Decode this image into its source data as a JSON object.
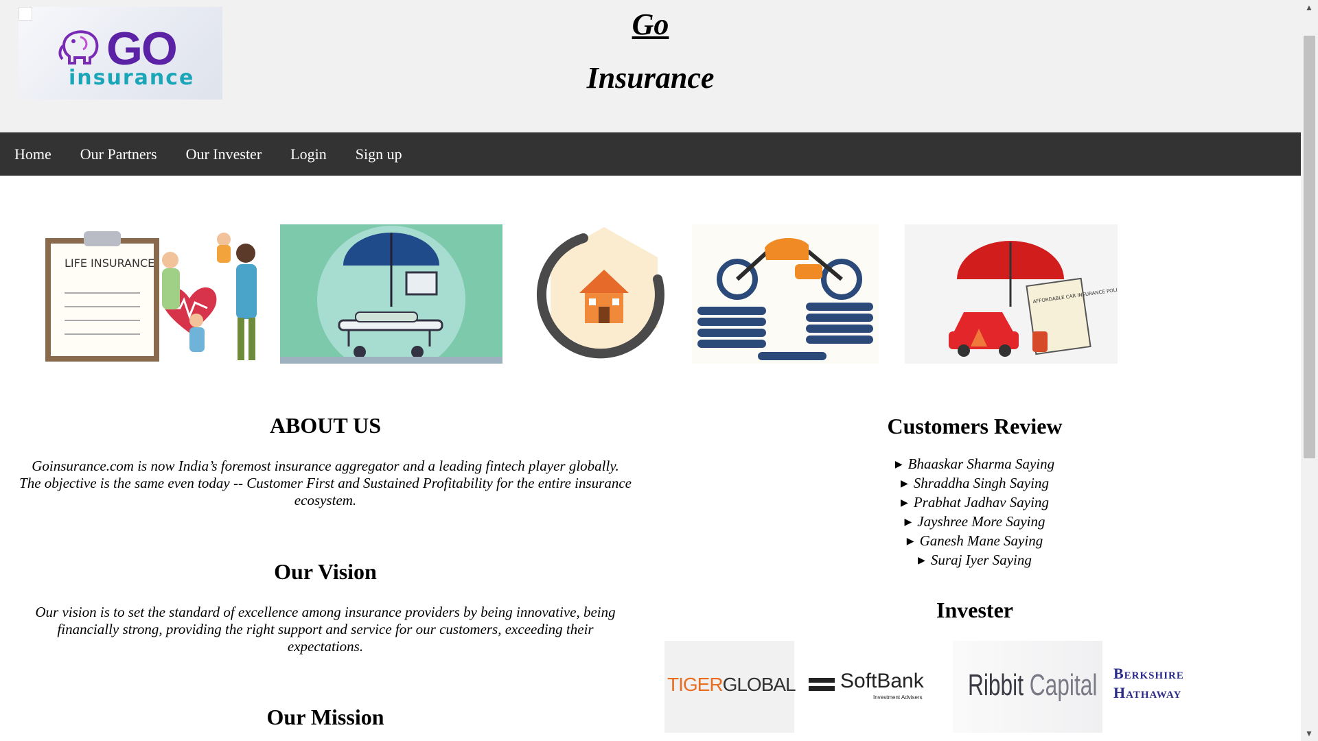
{
  "header": {
    "logo_go": "GO",
    "logo_insurance": "insurance",
    "title_line1": "Go",
    "title_line2": "Insurance"
  },
  "nav": {
    "items": [
      "Home",
      "Our Partners",
      "Our Invester",
      "Login",
      "Sign up"
    ]
  },
  "gallery": {
    "life_label": "LIFE INSURANCE",
    "car_policy_label": "AFFORDABLE CAR INSURANCE POLICY"
  },
  "about": {
    "title": "ABOUT US",
    "text": "Goinsurance.com is now India’s foremost insurance aggregator and a leading fintech player globally. The objective is the same even today -- Customer First and Sustained Profitability for the entire insurance ecosystem."
  },
  "vision": {
    "title": "Our Vision",
    "text": "Our vision is to set the standard of excellence among insurance providers by being innovative, being financially strong, providing the right support and service for our customers, exceeding their expectations."
  },
  "mission": {
    "title": "Our Mission"
  },
  "reviews": {
    "title": "Customers Review",
    "items": [
      "Bhaaskar Sharma Saying",
      "Shraddha Singh Saying",
      "Prabhat Jadhav Saying",
      "Jayshree More Saying",
      "Ganesh Mane Saying",
      "Suraj Iyer Saying"
    ]
  },
  "investors": {
    "title": "Invester",
    "tiger_a": "TIGER",
    "tiger_b": "GLOBAL",
    "softbank": "SoftBank",
    "softbank_sub": "Investment Advisers",
    "ribbit_a": "Ribbit",
    "ribbit_b": "Capital",
    "berkshire_1": "Berkshire",
    "berkshire_2": "Hathaway"
  }
}
